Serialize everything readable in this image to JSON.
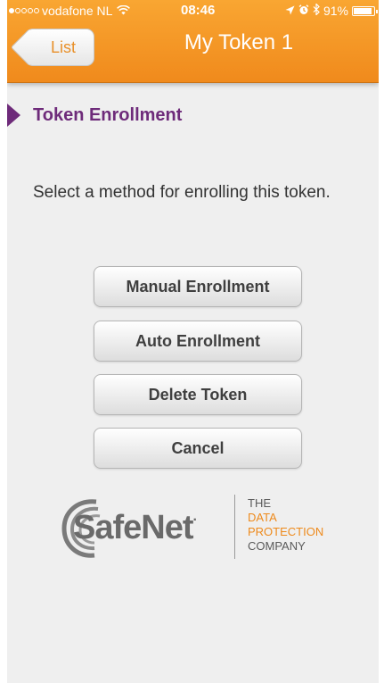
{
  "status_bar": {
    "carrier": "vodafone NL",
    "time": "08:46",
    "battery": "91%",
    "battery_level": 0.91,
    "signal_bars_filled": 1,
    "signal_bars_total": 5
  },
  "nav": {
    "back_label": "List",
    "title": "My Token 1"
  },
  "section": {
    "title": "Token Enrollment",
    "instructions": "Select a method for enrolling this token."
  },
  "buttons": {
    "manual": "Manual Enrollment",
    "auto": "Auto Enrollment",
    "delete": "Delete Token",
    "cancel": "Cancel"
  },
  "logo": {
    "brand": "SafeNet",
    "tagline_line1": "THE",
    "tagline_line2": "DATA",
    "tagline_line3": "PROTECTION",
    "tagline_line4": "COMPANY"
  },
  "colors": {
    "header_orange": "#f39a26",
    "accent_purple": "#6e2b7a",
    "tagline_orange": "#ee8a1c"
  }
}
